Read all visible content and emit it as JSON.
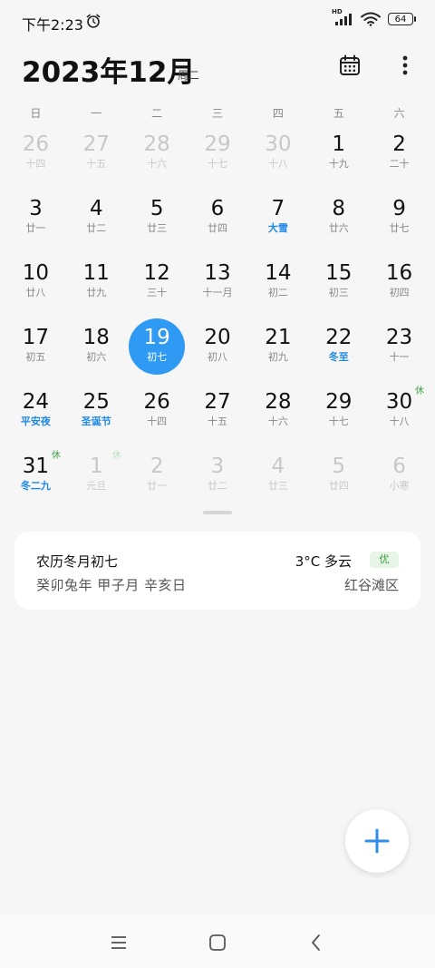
{
  "status_bar": {
    "time": "下午2:23",
    "alarm_icon": "alarm-clock-icon",
    "network_label": "HD",
    "signal_icon": "cellular-signal-icon",
    "wifi_icon": "wifi-icon",
    "battery": "64"
  },
  "header": {
    "title": "2023年12月",
    "weekday": "周二",
    "calendar_icon": "calendar-icon",
    "more_icon": "more-vertical-icon"
  },
  "weekdays": [
    "日",
    "一",
    "二",
    "三",
    "四",
    "五",
    "六"
  ],
  "days": [
    {
      "day": "26",
      "lunar": "十四",
      "faded": true
    },
    {
      "day": "27",
      "lunar": "十五",
      "faded": true
    },
    {
      "day": "28",
      "lunar": "十六",
      "faded": true
    },
    {
      "day": "29",
      "lunar": "十七",
      "faded": true
    },
    {
      "day": "30",
      "lunar": "十八",
      "faded": true
    },
    {
      "day": "1",
      "lunar": "十九"
    },
    {
      "day": "2",
      "lunar": "二十"
    },
    {
      "day": "3",
      "lunar": "廿一"
    },
    {
      "day": "4",
      "lunar": "廿二"
    },
    {
      "day": "5",
      "lunar": "廿三"
    },
    {
      "day": "6",
      "lunar": "廿四"
    },
    {
      "day": "7",
      "lunar": "大雪",
      "festival": true
    },
    {
      "day": "8",
      "lunar": "廿六"
    },
    {
      "day": "9",
      "lunar": "廿七"
    },
    {
      "day": "10",
      "lunar": "廿八"
    },
    {
      "day": "11",
      "lunar": "廿九"
    },
    {
      "day": "12",
      "lunar": "三十"
    },
    {
      "day": "13",
      "lunar": "十一月"
    },
    {
      "day": "14",
      "lunar": "初二"
    },
    {
      "day": "15",
      "lunar": "初三"
    },
    {
      "day": "16",
      "lunar": "初四"
    },
    {
      "day": "17",
      "lunar": "初五"
    },
    {
      "day": "18",
      "lunar": "初六"
    },
    {
      "day": "19",
      "lunar": "初七",
      "today": true
    },
    {
      "day": "20",
      "lunar": "初八"
    },
    {
      "day": "21",
      "lunar": "初九"
    },
    {
      "day": "22",
      "lunar": "冬至",
      "festival": true
    },
    {
      "day": "23",
      "lunar": "十一"
    },
    {
      "day": "24",
      "lunar": "平安夜",
      "festival": true
    },
    {
      "day": "25",
      "lunar": "圣诞节",
      "festival": true
    },
    {
      "day": "26",
      "lunar": "十四"
    },
    {
      "day": "27",
      "lunar": "十五"
    },
    {
      "day": "28",
      "lunar": "十六"
    },
    {
      "day": "29",
      "lunar": "十七"
    },
    {
      "day": "30",
      "lunar": "十八",
      "rest": "休"
    },
    {
      "day": "31",
      "lunar": "冬二九",
      "festival": true,
      "rest": "休"
    },
    {
      "day": "1",
      "lunar": "元旦",
      "faded": true,
      "rest": "休"
    },
    {
      "day": "2",
      "lunar": "廿一",
      "faded": true
    },
    {
      "day": "3",
      "lunar": "廿二",
      "faded": true
    },
    {
      "day": "4",
      "lunar": "廿三",
      "faded": true
    },
    {
      "day": "5",
      "lunar": "廿四",
      "faded": true
    },
    {
      "day": "6",
      "lunar": "小寒",
      "faded": true
    }
  ],
  "info_card": {
    "lunar_date": "农历冬月初七",
    "ganzhi": "癸卯兔年 甲子月 辛亥日",
    "weather": "3°C 多云",
    "air_quality": "优",
    "location": "红谷滩区"
  },
  "fab": {
    "icon": "plus-icon"
  },
  "nav_bar": {
    "menu_icon": "menu-icon",
    "home_icon": "home-icon",
    "back_icon": "back-icon"
  },
  "colors": {
    "accent": "#2f9af4",
    "festival": "#1e88e5",
    "rest": "#43a047"
  }
}
